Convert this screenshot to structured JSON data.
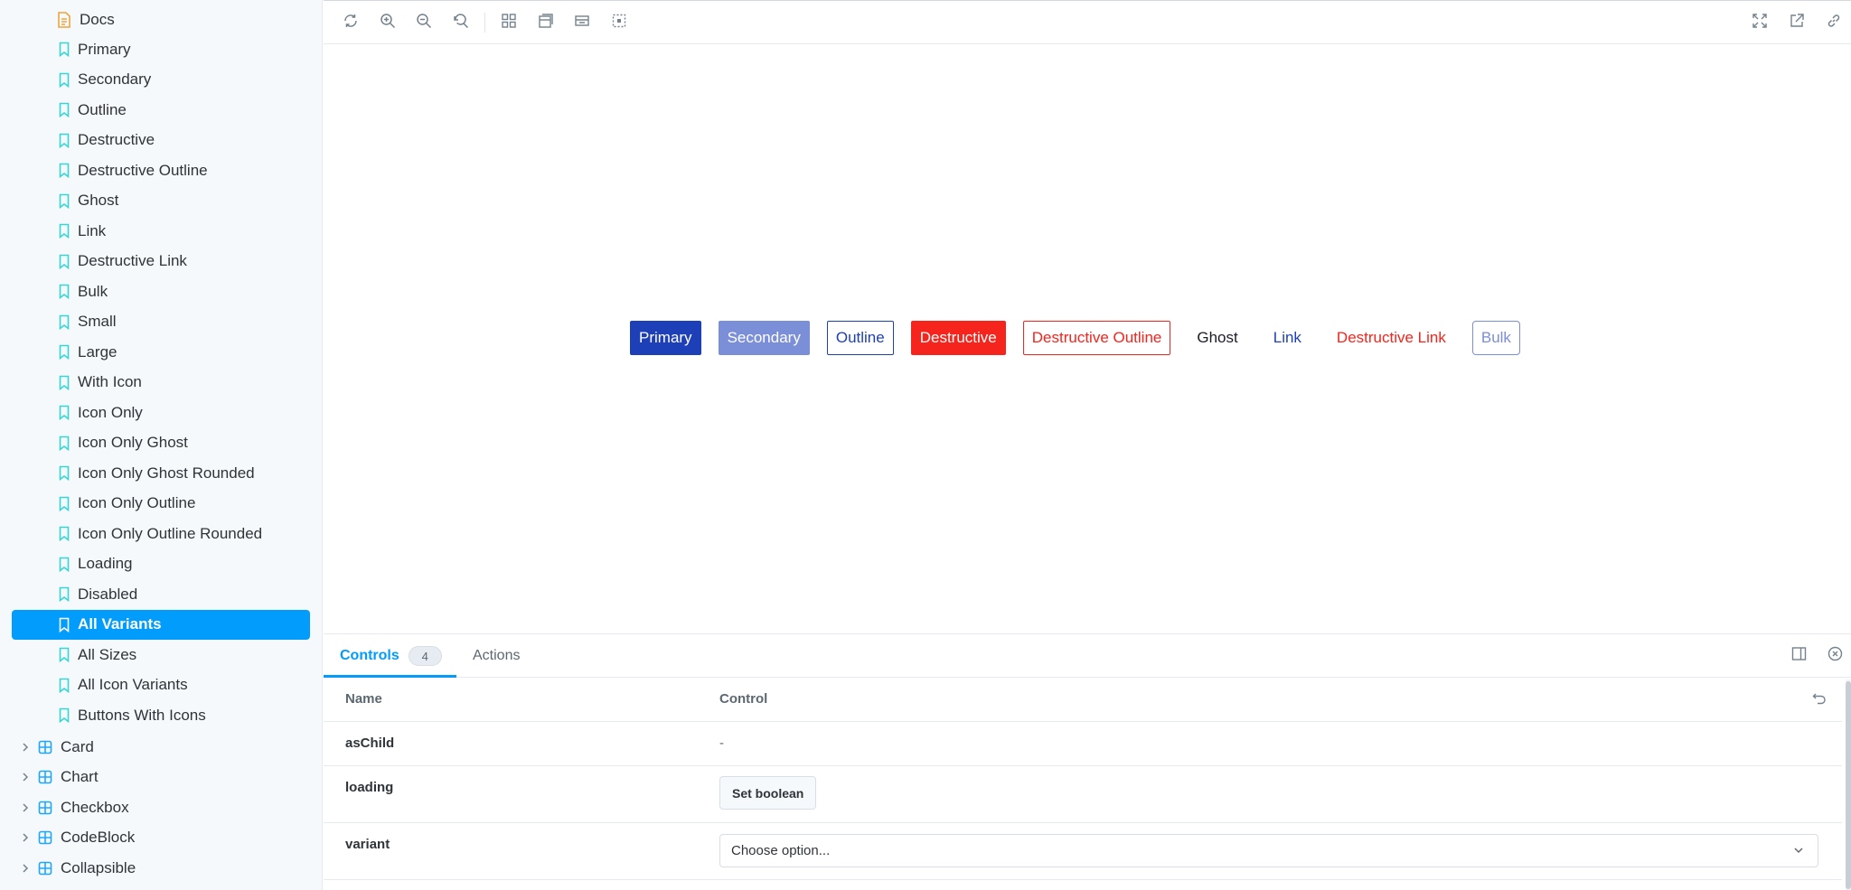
{
  "sidebar": {
    "docs_label": "Docs",
    "stories": [
      {
        "label": "Primary"
      },
      {
        "label": "Secondary"
      },
      {
        "label": "Outline"
      },
      {
        "label": "Destructive"
      },
      {
        "label": "Destructive Outline"
      },
      {
        "label": "Ghost"
      },
      {
        "label": "Link"
      },
      {
        "label": "Destructive Link"
      },
      {
        "label": "Bulk"
      },
      {
        "label": "Small"
      },
      {
        "label": "Large"
      },
      {
        "label": "With Icon"
      },
      {
        "label": "Icon Only"
      },
      {
        "label": "Icon Only Ghost"
      },
      {
        "label": "Icon Only Ghost Rounded"
      },
      {
        "label": "Icon Only Outline"
      },
      {
        "label": "Icon Only Outline Rounded"
      },
      {
        "label": "Loading"
      },
      {
        "label": "Disabled"
      },
      {
        "label": "All Variants",
        "selected": true
      },
      {
        "label": "All Sizes"
      },
      {
        "label": "All Icon Variants"
      },
      {
        "label": "Buttons With Icons"
      }
    ],
    "groups": [
      {
        "label": "Card"
      },
      {
        "label": "Chart"
      },
      {
        "label": "Checkbox"
      },
      {
        "label": "CodeBlock"
      },
      {
        "label": "Collapsible"
      }
    ]
  },
  "toolbar": {
    "left_icons": [
      "reload-icon",
      "zoom-in-icon",
      "zoom-out-icon",
      "zoom-reset-icon",
      "grid-icon",
      "background-icon",
      "viewport-icon",
      "outline-icon"
    ],
    "right_icons": [
      "fullscreen-icon",
      "open-new-tab-icon",
      "copy-link-icon"
    ]
  },
  "canvas": {
    "buttons": [
      {
        "label": "Primary",
        "variant": "primary"
      },
      {
        "label": "Secondary",
        "variant": "secondary"
      },
      {
        "label": "Outline",
        "variant": "outline"
      },
      {
        "label": "Destructive",
        "variant": "destructive"
      },
      {
        "label": "Destructive Outline",
        "variant": "destructive-outline"
      },
      {
        "label": "Ghost",
        "variant": "ghost"
      },
      {
        "label": "Link",
        "variant": "link"
      },
      {
        "label": "Destructive Link",
        "variant": "destructive-link"
      },
      {
        "label": "Bulk",
        "variant": "bulk"
      }
    ]
  },
  "addons": {
    "tabs": [
      {
        "label": "Controls",
        "badge": "4",
        "active": true
      },
      {
        "label": "Actions"
      }
    ],
    "table": {
      "header_name": "Name",
      "header_control": "Control",
      "rows": [
        {
          "name": "asChild",
          "value": "-"
        },
        {
          "name": "loading",
          "button": "Set boolean"
        },
        {
          "name": "variant",
          "select": "Choose option..."
        }
      ]
    }
  },
  "colors": {
    "accent": "#029cfd",
    "primary": "#1d3fb8",
    "secondary": "#7b8ed8",
    "destructive": "#f5241c",
    "doc_icon": "#f0a33b",
    "story_icon": "#37d5d3",
    "component_icon": "#1ea7fd"
  }
}
